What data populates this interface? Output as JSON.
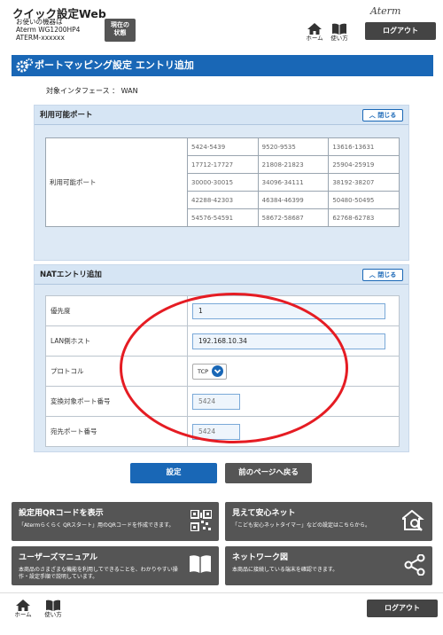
{
  "header": {
    "app_title": "クイック設定Web",
    "model_line1": "お使いの機器は",
    "model_line2": "Aterm WG1200HP4",
    "model_line3": "ATERM-xxxxxx",
    "state_btn_line1": "現在の",
    "state_btn_line2": "状態",
    "logo": "Aterm",
    "home_label": "ホーム",
    "help_label": "使い方",
    "logout_label": "ログアウト"
  },
  "page": {
    "title": "ポートマッピング設定 エントリ追加",
    "interface_label": "対象インタフェース ： WAN"
  },
  "ports_section": {
    "heading": "利用可能ポート",
    "close_label": "閉じる",
    "row_label": "利用可能ポート",
    "rows": [
      [
        "5424-5439",
        "9520-9535",
        "13616-13631"
      ],
      [
        "17712-17727",
        "21808-21823",
        "25904-25919"
      ],
      [
        "30000-30015",
        "34096-34111",
        "38192-38207"
      ],
      [
        "42288-42303",
        "46384-46399",
        "50480-50495"
      ],
      [
        "54576-54591",
        "58672-58687",
        "62768-62783"
      ]
    ]
  },
  "nat_section": {
    "heading": "NATエントリ追加",
    "close_label": "閉じる",
    "fields": {
      "priority_label": "優先度",
      "priority_value": "1",
      "lan_host_label": "LAN側ホスト",
      "lan_host_value": "192.168.10.34",
      "protocol_label": "プロトコル",
      "protocol_value": "TCP",
      "conv_port_label": "変換対象ポート番号",
      "conv_port_value": "5424",
      "dest_port_label": "宛先ポート番号",
      "dest_port_value": "5424"
    }
  },
  "actions": {
    "set_label": "設定",
    "back_label": "前のページへ戻る"
  },
  "tiles": {
    "qr_title": "設定用QRコードを表示",
    "qr_desc": "「Atermらくらく QRスタート」用のQRコードを作成できます。",
    "safety_title": "見えて安心ネット",
    "safety_desc": "「こども安心ネットタイマー」などの設定はこちらから。",
    "manual_title": "ユーザーズマニュアル",
    "manual_desc": "本商品のさまざまな機能を利用してできることを、わかりやすい操作・設定手順で説明しています。",
    "network_title": "ネットワーク図",
    "network_desc": "本商品に接続している端末を確認できます。"
  },
  "footer": {
    "home_label": "ホーム",
    "help_label": "使い方",
    "logout_label": "ログアウト"
  },
  "colors": {
    "primary_blue": "#1967b6",
    "dark_gray": "#555555",
    "annotation_red": "#e51c23"
  }
}
